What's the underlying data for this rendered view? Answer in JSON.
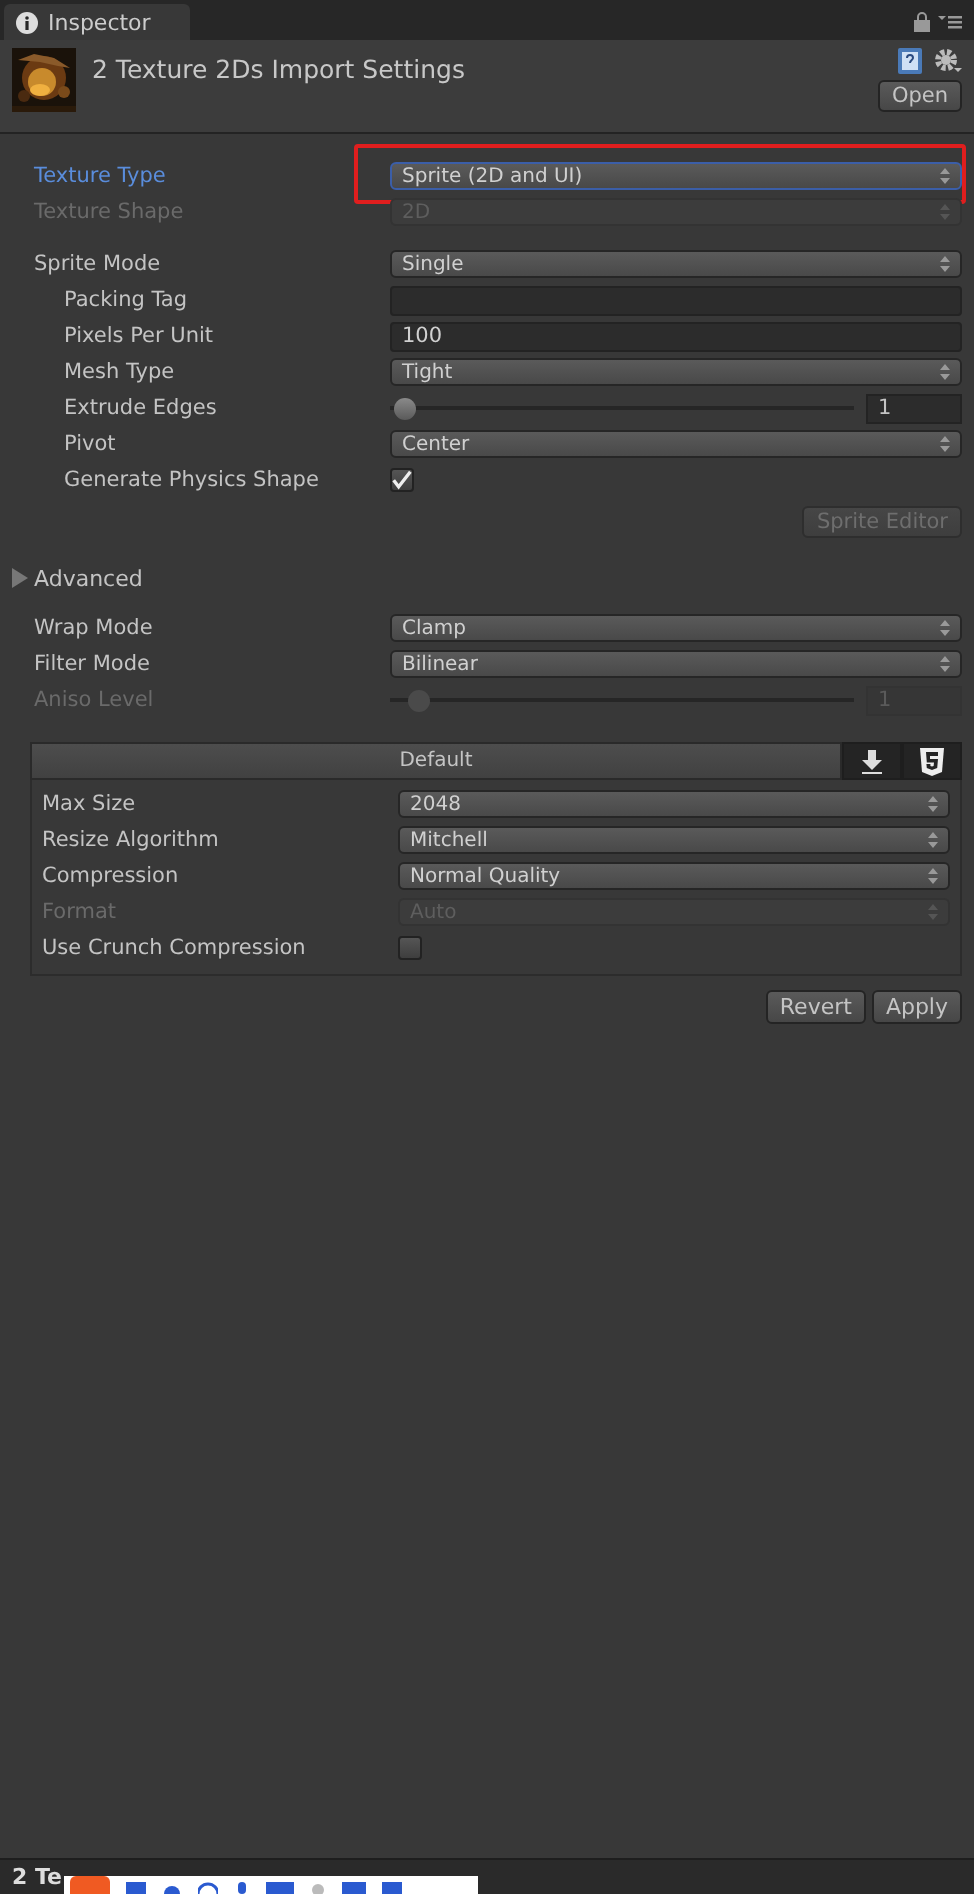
{
  "tab": {
    "title": "Inspector"
  },
  "header": {
    "title": "2 Texture 2Ds Import Settings",
    "open_button": "Open"
  },
  "type_rows": [
    {
      "kind": "dropdown",
      "label": "Texture Type",
      "value": "Sprite (2D and UI)",
      "disabled": false,
      "focused": true,
      "annotated": true
    },
    {
      "kind": "dropdown",
      "label": "Texture Shape",
      "value": "2D",
      "disabled": true,
      "focused": false
    }
  ],
  "sprite_rows": [
    {
      "kind": "dropdown",
      "label": "Sprite Mode",
      "value": "Single",
      "disabled": false,
      "children": [
        {
          "kind": "text",
          "label": "Packing Tag"
        },
        {
          "kind": "text",
          "label": "Pixels Per Unit",
          "value": "100"
        },
        {
          "kind": "dropdown",
          "label": "Mesh Type",
          "value": "Tight",
          "disabled": false
        },
        {
          "kind": "slider",
          "label": "Extrude Edges",
          "value": "1",
          "level": 0.03,
          "disabled": false
        },
        {
          "kind": "dropdown",
          "label": "Pivot",
          "value": "Center",
          "disabled": false
        },
        {
          "kind": "checkbox",
          "label": "Generate Physics Shape",
          "checked": true,
          "disabled": false
        }
      ]
    }
  ],
  "sprite_editor_button": {
    "label": "Sprite Editor",
    "disabled": true
  },
  "advanced": {
    "label": "Advanced",
    "expanded": false
  },
  "sampling_rows": [
    {
      "kind": "dropdown",
      "label": "Wrap Mode",
      "value": "Clamp",
      "disabled": false
    },
    {
      "kind": "dropdown",
      "label": "Filter Mode",
      "value": "Bilinear",
      "disabled": false
    },
    {
      "kind": "slider",
      "label": "Aniso Level",
      "value": "1",
      "level": 0.06,
      "disabled": true
    }
  ],
  "platform": {
    "header": "Default",
    "tabs": [
      {
        "kind": "download"
      },
      {
        "kind": "html5"
      }
    ],
    "rows": [
      {
        "kind": "dropdown",
        "label": "Max Size",
        "value": "2048",
        "disabled": false
      },
      {
        "kind": "dropdown",
        "label": "Resize Algorithm",
        "value": "Mitchell",
        "disabled": false
      },
      {
        "kind": "dropdown",
        "label": "Compression",
        "value": "Normal Quality",
        "disabled": false
      },
      {
        "kind": "dropdown",
        "label": "Format",
        "value": "Auto",
        "disabled": true
      },
      {
        "kind": "checkbox",
        "label": "Use Crunch Compression",
        "checked": false,
        "disabled": false
      }
    ]
  },
  "buttons": [
    {
      "label": "Revert"
    },
    {
      "label": "Apply"
    }
  ],
  "status_bar": {
    "text": "2 Te"
  }
}
